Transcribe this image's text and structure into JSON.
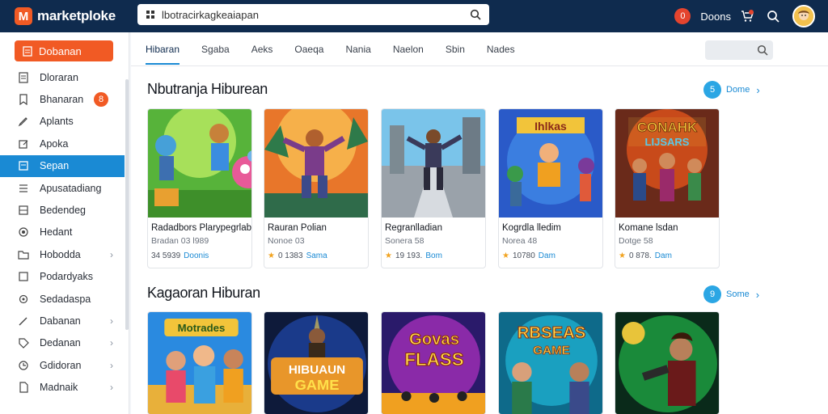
{
  "app": {
    "logo_letter": "M",
    "name": "marketploke"
  },
  "search": {
    "value": "lbotracirkagkeaiapan"
  },
  "header": {
    "notification_count": "0",
    "user_label": "Doons"
  },
  "sidebar": {
    "cta_label": "Dobanan",
    "items": [
      {
        "label": "Dloraran",
        "icon": "document-icon"
      },
      {
        "label": "Bhanaran",
        "icon": "bookmark-icon",
        "badge": "8"
      },
      {
        "label": "Aplants",
        "icon": "pencil-icon"
      },
      {
        "label": "Apoka",
        "icon": "edit-icon"
      },
      {
        "label": "Sepan",
        "icon": "store-icon",
        "active": true
      },
      {
        "label": "Apusatadiang",
        "icon": "list-icon"
      },
      {
        "label": "Bedendeg",
        "icon": "grid-icon"
      },
      {
        "label": "Hedant",
        "icon": "circle-icon"
      },
      {
        "label": "Hobodda",
        "icon": "folder-icon",
        "chevron": true
      },
      {
        "label": "Podardyaks",
        "icon": "note-icon"
      },
      {
        "label": "Sedadaspa",
        "icon": "gear-icon"
      },
      {
        "label": "Dabanan",
        "icon": "pen-icon",
        "chevron": true
      },
      {
        "label": "Dedanan",
        "icon": "tag-icon",
        "chevron": true
      },
      {
        "label": "Gdidoran",
        "icon": "clock-icon",
        "chevron": true
      },
      {
        "label": "Madnaik",
        "icon": "doc-icon",
        "chevron": true
      }
    ]
  },
  "tabs": [
    "Hibaran",
    "Sgaba",
    "Aeks",
    "Oaeqa",
    "Nania",
    "Naelon",
    "Sbin",
    "Nades"
  ],
  "sections": [
    {
      "title": "Nbutranja Hiburean",
      "more_count": "5",
      "more_label": "Dome",
      "cards": [
        {
          "name": "Radadbors Plarypegrlabouan",
          "sub": "Bradan 03 l989",
          "rating": "34 5939",
          "price": "Doonis",
          "star": false
        },
        {
          "name": "Rauran Polian",
          "sub": "Nonoe 03",
          "rating": "0 1383",
          "price": "Sama",
          "star": true
        },
        {
          "name": "Regranlladian",
          "sub": "Sonera 58",
          "rating": "19 193.",
          "price": "Bom",
          "star": true
        },
        {
          "name": "Kogrdla lledim",
          "sub": "Norea 48",
          "rating": "10780",
          "price": "Dam",
          "star": true
        },
        {
          "name": "Komane lsdan",
          "sub": "Dotge 58",
          "rating": "0 878.",
          "price": "Dam",
          "star": true
        }
      ]
    },
    {
      "title": "Kagaoran Hiburan",
      "more_count": "9",
      "more_label": "Some",
      "cards": [
        {
          "art_text": "Motrades"
        },
        {
          "art_text": "HIBUAUN GAME"
        },
        {
          "art_text": "Govas FLASS"
        },
        {
          "art_text": "RBSEAS GAME"
        },
        {
          "art_text": ""
        }
      ]
    }
  ],
  "card_art_lines": {
    "s1c4_top": "Ihlkas",
    "s1c5_top": "CONAHK",
    "s1c5_bot": "LIJSARS"
  },
  "colors": {
    "topbar": "#0f2b4e",
    "accent_orange": "#f15a24",
    "accent_blue": "#1a8ad4"
  }
}
